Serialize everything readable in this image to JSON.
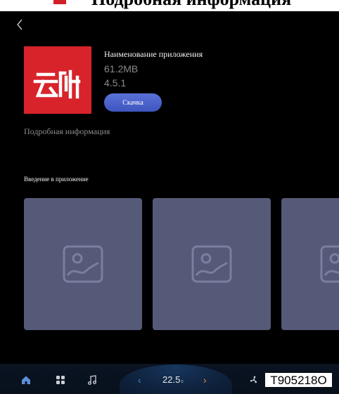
{
  "banner": {
    "title": "Подробная информация",
    "accent_color": "#d11f26"
  },
  "header": {
    "back_icon": "chevron-left-icon"
  },
  "app": {
    "name": "Наименование приложения",
    "size": "61.2MB",
    "version": "4.5.1",
    "download_label": "Скачка",
    "icon_color": "#d8232a",
    "icon_name": "app-logo-icon"
  },
  "details_link": "Подробная информация",
  "intro": {
    "title": "Введение в приложение",
    "screenshots": [
      {
        "icon": "image-placeholder-icon"
      },
      {
        "icon": "image-placeholder-icon"
      },
      {
        "icon": "image-placeholder-icon"
      }
    ]
  },
  "dock": {
    "items": [
      {
        "icon": "home-icon"
      },
      {
        "icon": "apps-grid-icon"
      },
      {
        "icon": "music-icon"
      }
    ],
    "climate": {
      "temperature": "22.5",
      "unit": "c",
      "down_icon": "chevron-left-icon",
      "up_icon": "chevron-right-icon"
    },
    "fan_icon": "fan-icon"
  },
  "overlay_code": "T905218O",
  "colors": {
    "background": "#000000",
    "accent_blue": "#4a63cc",
    "placeholder": "#555a78",
    "temp_cold": "#3e86e6",
    "temp_hot": "#f08a2a"
  }
}
